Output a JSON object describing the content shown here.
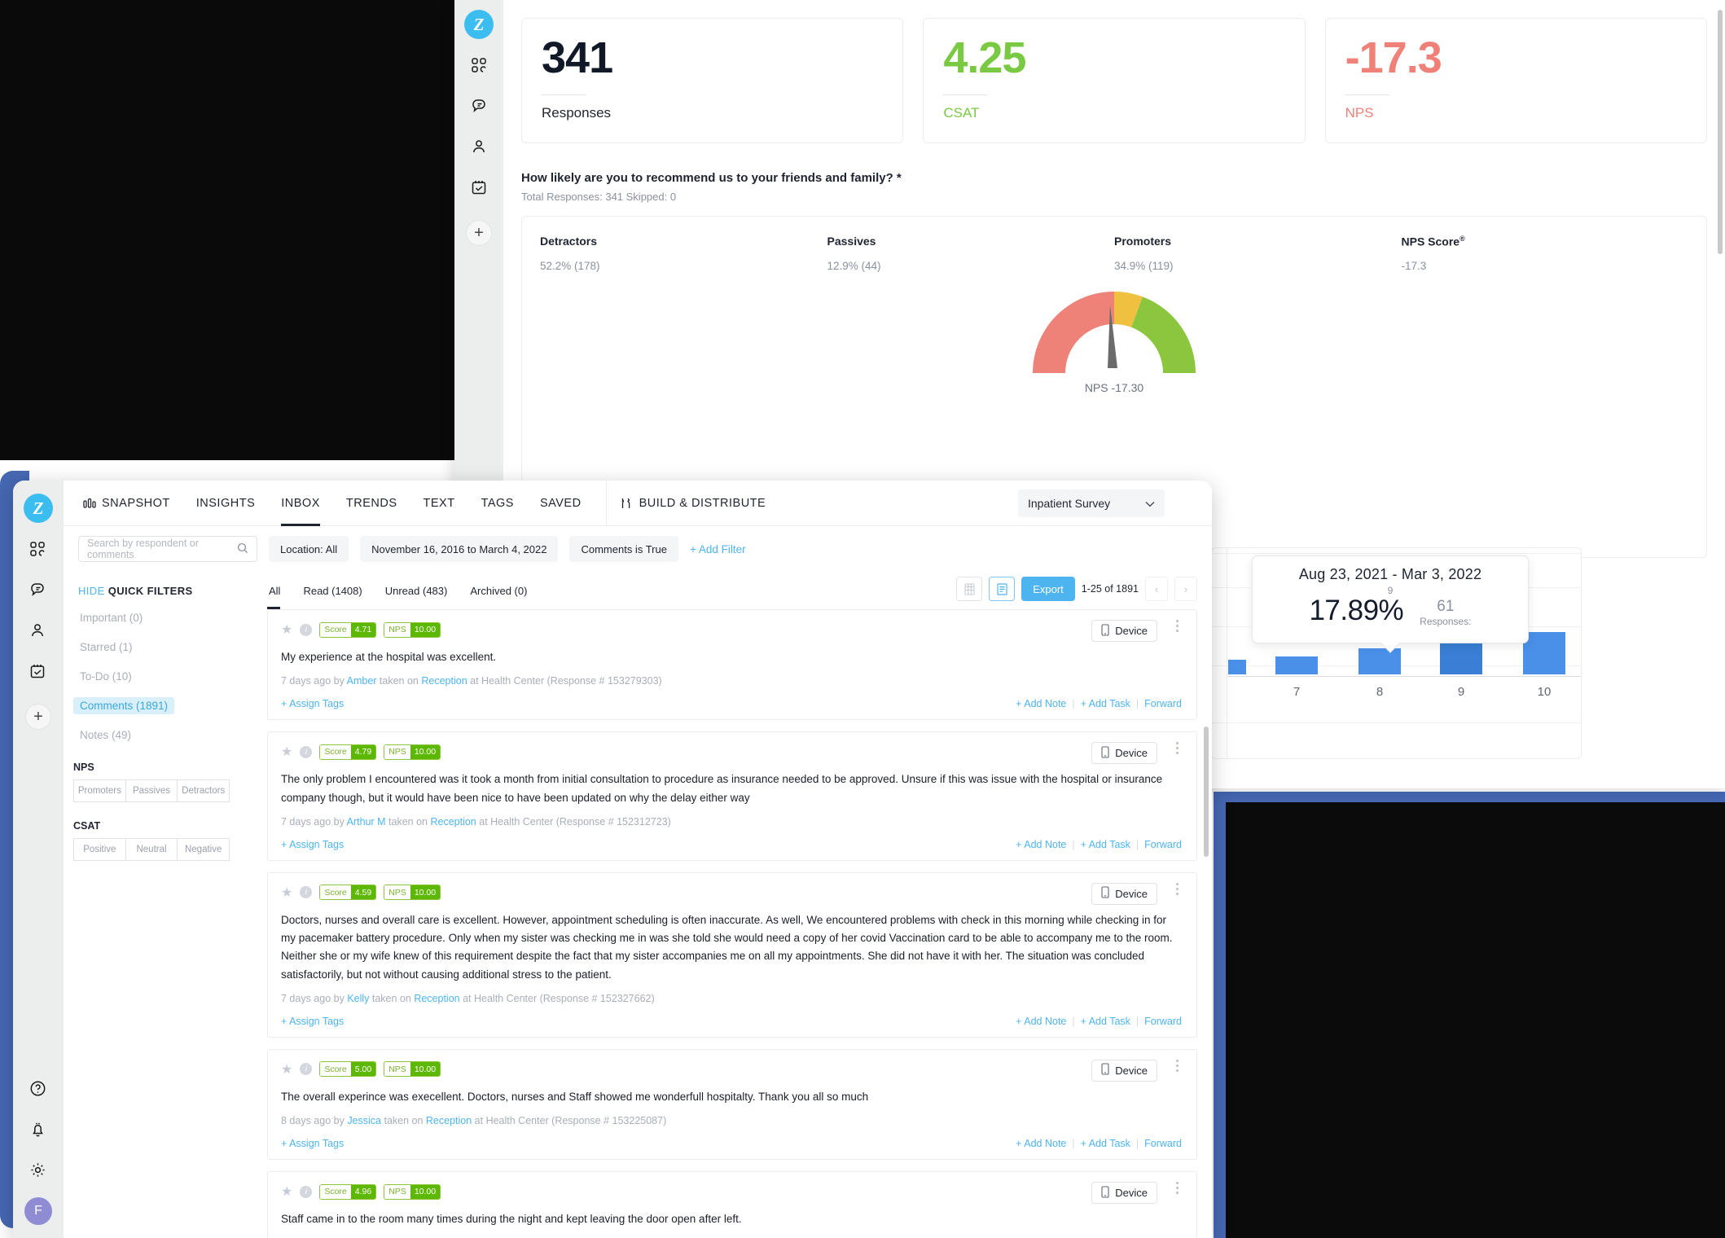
{
  "snapshot": {
    "rail": {
      "logo": "Z",
      "icons": [
        "grid-icon",
        "chat-icon",
        "contacts-icon",
        "calendar-check-icon"
      ],
      "add_label": "+"
    },
    "kpis": [
      {
        "value": "341",
        "label": "Responses",
        "color": "#111827"
      },
      {
        "value": "4.25",
        "label": "CSAT",
        "color": "#7ac943"
      },
      {
        "value": "-17.3",
        "label": "NPS",
        "color": "#ef8178"
      }
    ],
    "question": {
      "title": "How likely are you to recommend us to your friends and family? *",
      "subtitle": "Total Responses: 341   Skipped: 0"
    },
    "nps_breakdown": [
      {
        "header": "Detractors",
        "value": "52.2% (178)"
      },
      {
        "header": "Passives",
        "value": "12.9% (44)"
      },
      {
        "header": "Promoters",
        "value": "34.9% (119)"
      },
      {
        "header": "NPS Score",
        "value": "-17.3",
        "reg": "®"
      }
    ],
    "gauge": {
      "caption": "NPS -17.30",
      "detractor_color": "#ee8279",
      "passive_color": "#f0c040",
      "promoter_color": "#8cc63f",
      "needle_color": "#6b6b6b"
    }
  },
  "histogram_tooltip": {
    "range": "Aug 23, 2021 - Mar 3, 2022",
    "bucket": "9",
    "percent": "17.89%",
    "responses_count": "61",
    "responses_label": "Responses:"
  },
  "chart_data": {
    "type": "bar",
    "title": "",
    "xlabel": "",
    "ylabel": "",
    "categories": [
      "7",
      "8",
      "9",
      "10"
    ],
    "values": [
      4.2,
      7.5,
      17.89,
      16.2
    ],
    "highlight_index": 2,
    "bar_color": "#4a90e8",
    "highlight_color": "#3a7fd5",
    "grid": true,
    "legend": "none"
  },
  "inbox": {
    "rail": {
      "logo": "Z",
      "icons": [
        "grid-icon",
        "chat-icon",
        "contacts-icon",
        "calendar-check-icon"
      ],
      "add_label": "+",
      "bottom_icons": [
        "help-icon",
        "bell-icon",
        "gear-icon"
      ],
      "avatar_initial": "F"
    },
    "nav": [
      {
        "label": "SNAPSHOT",
        "icon": "bars-icon",
        "active": false
      },
      {
        "label": "INSIGHTS",
        "active": false
      },
      {
        "label": "INBOX",
        "active": true
      },
      {
        "label": "TRENDS",
        "active": false
      },
      {
        "label": "TEXT",
        "active": false
      },
      {
        "label": "TAGS",
        "active": false
      },
      {
        "label": "SAVED",
        "active": false
      },
      {
        "label": "BUILD & DISTRIBUTE",
        "icon": "tools-icon",
        "active": false
      }
    ],
    "survey_select": {
      "value": "Inpatient Survey",
      "caret": "chevron-down-icon"
    },
    "filters": {
      "search_placeholder": "Search by respondent or comments",
      "location": "Location: All",
      "date_range": "November 16, 2016 to March 4, 2022",
      "comments": "Comments is True",
      "add_filter": "+ Add Filter"
    },
    "quick_filters": {
      "hide": "HIDE",
      "title": "QUICK FILTERS",
      "items": [
        {
          "label": "Important (0)",
          "selected": false
        },
        {
          "label": "Starred (1)",
          "selected": false
        },
        {
          "label": "To-Do (10)",
          "selected": false
        },
        {
          "label": "Comments (1891)",
          "selected": true
        },
        {
          "label": "Notes (49)",
          "selected": false
        }
      ],
      "nps_section": "NPS",
      "nps_options": [
        "Promoters",
        "Passives",
        "Detractors"
      ],
      "csat_section": "CSAT",
      "csat_options": [
        "Positive",
        "Neutral",
        "Negative"
      ]
    },
    "list_tabs": [
      {
        "label": "All",
        "active": true
      },
      {
        "label": "Read (1408)",
        "active": false
      },
      {
        "label": "Unread (483)",
        "active": false
      },
      {
        "label": "Archived (0)",
        "active": false
      }
    ],
    "tools": {
      "grid_view": "grid-view-icon",
      "list_view": "list-view-icon",
      "export": "Export",
      "pagination": "1-25 of 1891",
      "prev": "‹",
      "next": "›"
    },
    "card_actions": {
      "assign_tags": "+ Assign Tags",
      "add_note": "+ Add Note",
      "add_task": "+ Add Task",
      "forward": "Forward"
    },
    "device_label": "Device",
    "cards": [
      {
        "score_key": "Score",
        "score_value": "4.71",
        "nps_key": "NPS",
        "nps_value": "10.00",
        "text": "My experience at the hospital was excellent.",
        "meta_time": "7 days ago by ",
        "meta_user": "Amber",
        "meta_mid": " taken on ",
        "meta_channel": "Reception",
        "meta_tail": " at Health Center (Response # 153279303)",
        "has_actions": true
      },
      {
        "score_key": "Score",
        "score_value": "4.79",
        "nps_key": "NPS",
        "nps_value": "10.00",
        "text": "The only problem I encountered was it took a month from initial consultation to procedure as insurance needed to be approved. Unsure if this was issue with the hospital or insurance company though, but it would have been nice to have been updated on why the delay either way",
        "meta_time": "7 days ago by ",
        "meta_user": "Arthur M",
        "meta_mid": " taken on ",
        "meta_channel": "Reception",
        "meta_tail": " at Health Center (Response # 152312723)",
        "has_actions": true
      },
      {
        "score_key": "Score",
        "score_value": "4.59",
        "nps_key": "NPS",
        "nps_value": "10.00",
        "text": "Doctors, nurses and overall care is excellent. However, appointment scheduling is often inaccurate. As well, We encountered problems with check in this morning while checking in for my pacemaker battery procedure. Only when my sister was checking me in was she told she would need a copy of her covid Vaccination card to be able to accompany me to the room. Neither she or my wife knew of this requirement despite the fact that my sister accompanies me on all my appointments. She did not have it with her. The situation was concluded satisfactorily, but not without causing additional stress to the patient.",
        "meta_time": "7 days ago by ",
        "meta_user": "Kelly",
        "meta_mid": " taken on ",
        "meta_channel": "Reception",
        "meta_tail": " at Health Center (Response # 152327662)",
        "has_actions": true
      },
      {
        "score_key": "Score",
        "score_value": "5.00",
        "nps_key": "NPS",
        "nps_value": "10.00",
        "text": "The overall experince was execellent. Doctors, nurses and Staff showed me wonderfull hospitalty. Thank you all so much",
        "meta_time": "8 days ago by ",
        "meta_user": "Jessica",
        "meta_mid": " taken on ",
        "meta_channel": "Reception",
        "meta_tail": " at Health Center (Response # 153225087)",
        "has_actions": true
      },
      {
        "score_key": "Score",
        "score_value": "4.96",
        "nps_key": "NPS",
        "nps_value": "10.00",
        "text": "Staff came in to the room many times during the night and kept leaving the door open after left.",
        "meta_time": "",
        "meta_user": "",
        "meta_mid": "",
        "meta_channel": "",
        "meta_tail": "",
        "has_actions": false
      }
    ]
  }
}
